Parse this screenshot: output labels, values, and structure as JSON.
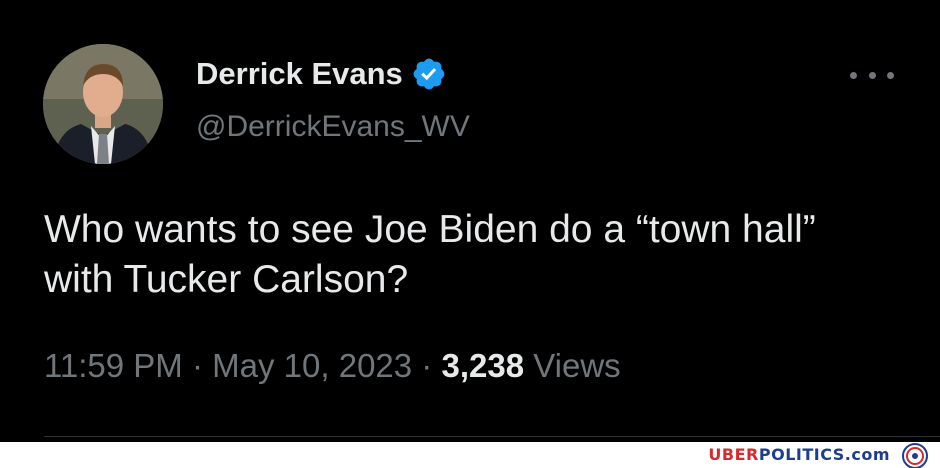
{
  "tweet": {
    "author_name": "Derrick Evans",
    "author_handle": "@DerrickEvans_WV",
    "text": "Who wants to see Joe Biden do a “town hall” with Tucker Carlson?",
    "time": "11:59 PM",
    "separator": "·",
    "date": "May 10, 2023",
    "views_count": "3,238",
    "views_label": "Views"
  },
  "icons": {
    "verified": "verified-badge-icon",
    "more": "more-options-icon",
    "verified_color": "#1d9bf0"
  },
  "watermark": {
    "brand_part1": "UBER",
    "brand_part2": "POLITICS.com",
    "color_red": "#d62b2b",
    "color_blue": "#1d3d8f"
  }
}
